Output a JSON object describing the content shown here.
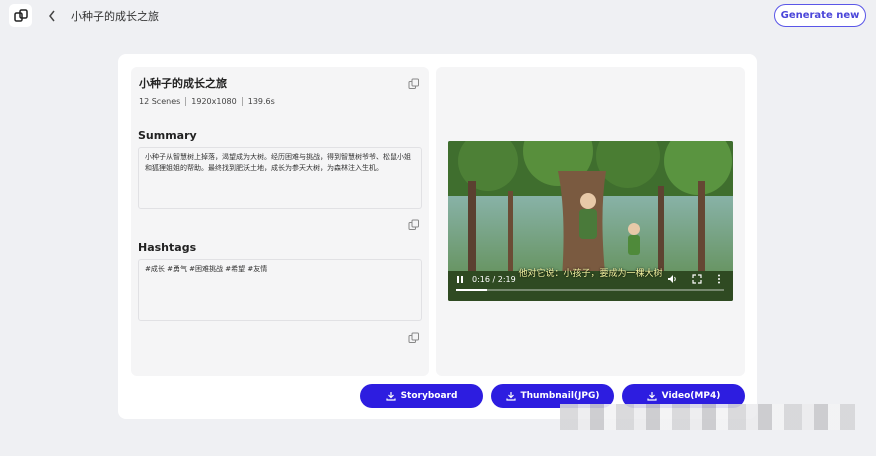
{
  "header": {
    "title": "小种子的成长之旅",
    "generate_button": "Generate new"
  },
  "project": {
    "title": "小种子的成长之旅",
    "scenes": "12 Scenes",
    "resolution": "1920x1080",
    "duration": "139.6s"
  },
  "summary": {
    "heading": "Summary",
    "text": "小种子从智慧树上掉落，渴望成为大树。经历困难与挑战，得到智慧树爷爷、松鼠小姐和狐狸姐姐的帮助。最终找到肥沃土地，成长为参天大树，为森林注入生机。"
  },
  "hashtags": {
    "heading": "Hashtags",
    "text": "#成长 #勇气 #困难挑战 #希望 #友情"
  },
  "player": {
    "time": "0:16 / 2:19",
    "subtitle": "他对它说：小孩子，要成为一棵大树",
    "progress": 0.115
  },
  "actions": {
    "storyboard": "Storyboard",
    "thumbnail": "Thumbnail(JPG)",
    "video": "Video(MP4)"
  },
  "colors": {
    "accent": "#2d1de0",
    "outline": "#5a56e8"
  }
}
